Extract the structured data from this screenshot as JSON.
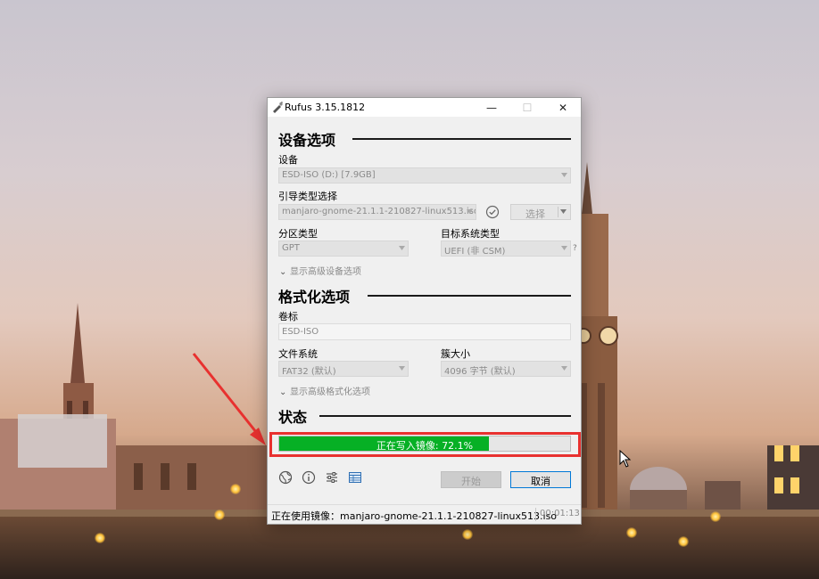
{
  "window": {
    "title": "Rufus 3.15.1812",
    "controls": {
      "minimize": "—",
      "maximize": "☐",
      "close": "✕"
    }
  },
  "device_section": {
    "heading": "设备选项",
    "device_label": "设备",
    "device_value": "ESD-ISO (D:) [7.9GB]",
    "boot_label": "引导类型选择",
    "boot_value": "manjaro-gnome-21.1.1-210827-linux513.iso",
    "select_button": "选择",
    "partition_label": "分区类型",
    "partition_value": "GPT",
    "target_label": "目标系统类型",
    "target_value": "UEFI (非 CSM)",
    "target_help": "?",
    "advanced_toggle": "显示高级设备选项"
  },
  "format_section": {
    "heading": "格式化选项",
    "volume_label": "卷标",
    "volume_value": "ESD-ISO",
    "fs_label": "文件系统",
    "fs_value": "FAT32 (默认)",
    "cluster_label": "簇大小",
    "cluster_value": "4096 字节 (默认)",
    "advanced_toggle": "显示高级格式化选项"
  },
  "status_section": {
    "heading": "状态",
    "progress_text": "正在写入镜像: 72.1%",
    "progress_fraction": 0.721
  },
  "toolbar": {
    "icons": [
      "globe-icon",
      "info-icon",
      "settings-icon",
      "log-icon"
    ],
    "start_button": "开始",
    "cancel_button": "取消"
  },
  "statusbar": {
    "message": "正在使用镜像：manjaro-gnome-21.1.1-210827-linux513.iso",
    "elapsed": "00:01:13"
  },
  "colors": {
    "progress_green": "#06b025",
    "highlight_red": "#e8312f",
    "window_bg": "#f0f0f0",
    "focus_blue": "#0078d7"
  }
}
